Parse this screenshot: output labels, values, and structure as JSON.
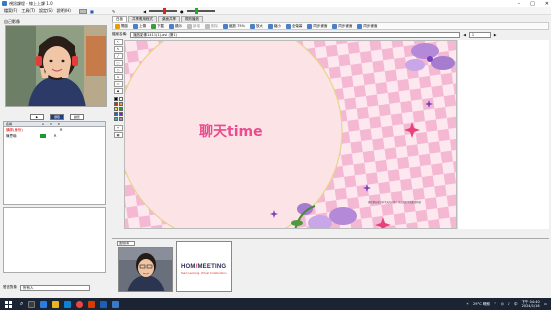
{
  "window": {
    "title": "視訊課程 - 線上上課 1.0"
  },
  "menubar": {
    "items": [
      "檔案(F)",
      "工具(T)",
      "設定(S)",
      "說明(H)"
    ],
    "rec_label": "■",
    "vol_label": "◀(×)"
  },
  "left_panel": {
    "video_title": "自己影像",
    "video_buttons": [
      "▶",
      "擷取",
      "錄影"
    ],
    "user_table": {
      "headers": [
        "名稱",
        "A",
        "V",
        "P"
      ],
      "rows": [
        {
          "name": "講師(身份)",
          "flag": "R",
          "mark": "green"
        },
        {
          "name": "陳思瑜",
          "flag": "R",
          "mark": "green"
        }
      ]
    },
    "chat_label": "發言對象",
    "chat_target": "所有人"
  },
  "tabs": [
    "白板",
    "共享應用程式",
    "桌面共享",
    "視訊播放"
  ],
  "toolbar": {
    "items": [
      {
        "label": "開啟",
        "icon": "folder-icon",
        "enabled": true
      },
      {
        "label": "上傳",
        "icon": "upload-icon",
        "enabled": true
      },
      {
        "label": "下載",
        "icon": "download-icon",
        "enabled": true
      },
      {
        "label": "顯示",
        "icon": "display-icon",
        "enabled": true
      },
      {
        "label": "新增",
        "icon": "new-page-icon",
        "enabled": false
      },
      {
        "label": "刪除",
        "icon": "delete-icon",
        "enabled": false
      },
      {
        "label": "縮放 75%",
        "icon": "zoom-icon",
        "enabled": true
      },
      {
        "label": "放大",
        "icon": "zoom-in-icon",
        "enabled": true
      },
      {
        "label": "縮小",
        "icon": "zoom-out-icon",
        "enabled": true
      },
      {
        "label": "全螢幕",
        "icon": "fullscreen-icon",
        "enabled": true
      },
      {
        "label": "同步畫面",
        "icon": "sync-icon",
        "enabled": true
      },
      {
        "label": "同步畫面",
        "icon": "sync2-icon",
        "enabled": true
      },
      {
        "label": "同步畫面",
        "icon": "sync3-icon",
        "enabled": true
      }
    ]
  },
  "docbar": {
    "label": "檔案名稱:",
    "doc_name": "播放影像1411(1).avi (第1)",
    "page": "1"
  },
  "whiteboard": {
    "text": "聊天time",
    "small_caption": "請在聊天室分享今天的心情！可以用文字或表情符號",
    "colors": {
      "bg_pink": "#f6c9dd",
      "circle_fill": "#fbe3e6",
      "circle_stroke": "#e9d48a",
      "text_color": "#ec4b8f",
      "checker_light": "#fde8ef",
      "flower_purple": "#b48ad8",
      "sparkle": "#7b3fc0"
    }
  },
  "thumbnails": {
    "label": "講師影像",
    "items": [
      {
        "type": "video"
      },
      {
        "type": "slide",
        "logo_a": "HOM",
        "logo_b": "MEETING",
        "subtitle": "Team Learning, Virtual Collaboration"
      }
    ]
  },
  "taskbar": {
    "weather": "29°C 晴朗",
    "time": "下午 04:40",
    "date": "2024/1/16",
    "lang": "中"
  }
}
